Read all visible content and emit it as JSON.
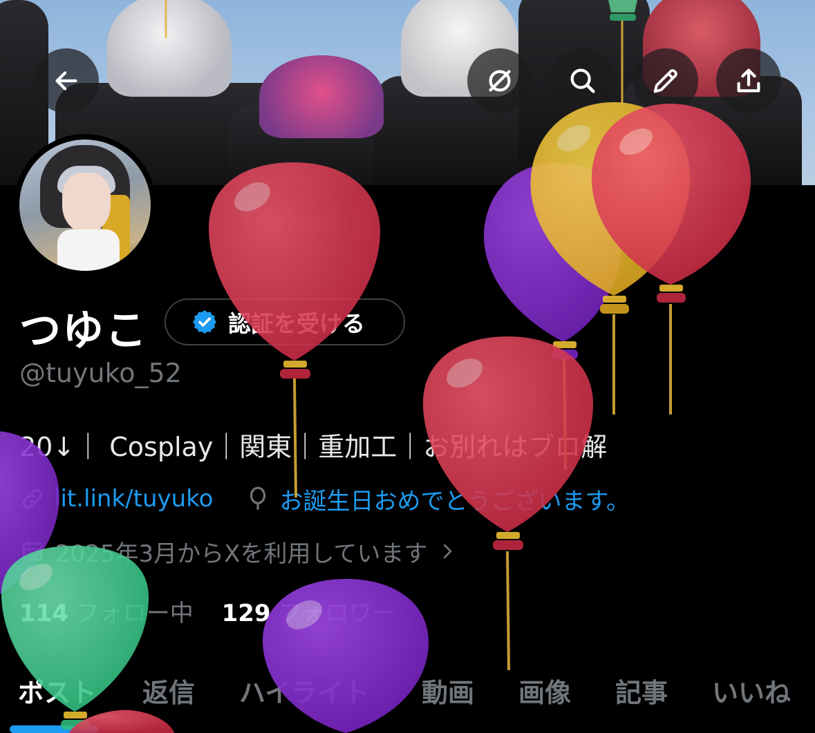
{
  "header": {
    "back_icon": "arrow-left-icon",
    "actions": [
      "grok-icon",
      "search-icon",
      "edit-icon",
      "share-icon"
    ]
  },
  "profile": {
    "name": "つゆこ",
    "verify_label": "認証を受ける",
    "handle": "@tuyuko_52",
    "bio": "20↓｜ Cosplay｜関東｜重加工｜お別れはブロ解",
    "link": "lit.link/tuyuko",
    "birthday": "お誕生日おめでとうございます。",
    "joined": "2025年3月からXを利用しています",
    "following_count": "114",
    "following_label": "フォロー中",
    "followers_count": "129",
    "followers_label": "フォロワー"
  },
  "tabs": [
    "ポスト",
    "返信",
    "ハイライト",
    "動画",
    "画像",
    "記事",
    "いいね"
  ],
  "active_tab": 0,
  "colors": {
    "accent": "#1d9bf0",
    "muted": "#71767b",
    "balloon_red": "#e0394f",
    "balloon_purple": "#8a2fd0",
    "balloon_yellow": "#f2c233",
    "balloon_green": "#4ed49a"
  }
}
